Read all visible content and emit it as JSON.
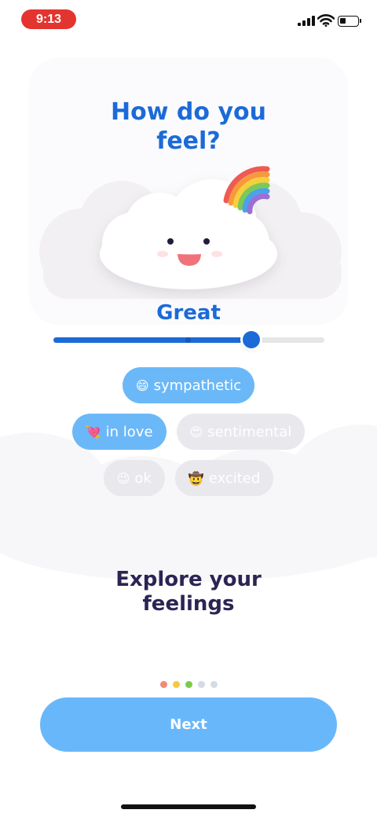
{
  "status_bar": {
    "time": "9:13"
  },
  "card": {
    "title": "How do you\nfeel?"
  },
  "mood": {
    "label": "Great",
    "slider_value": 0.73
  },
  "chips": [
    {
      "emoji": "😄",
      "label": "sympathetic",
      "selected": true
    },
    {
      "emoji": "💘",
      "label": "in love",
      "selected": true
    },
    {
      "emoji": "😍",
      "label": "sentimental",
      "selected": false
    },
    {
      "emoji": "😉",
      "label": "ok",
      "selected": false
    },
    {
      "emoji": "🤠",
      "label": "excited",
      "selected": false
    }
  ],
  "headline": "Explore your\nfeelings",
  "pagination": {
    "total": 5,
    "colors": [
      "#f08a7a",
      "#f5c944",
      "#7ccb4f",
      "#d4dbe6",
      "#d4dbe6"
    ]
  },
  "next_button": {
    "label": "Next"
  },
  "colors": {
    "accent": "#1c6ad8",
    "chip_on": "#6bb8f8",
    "chip_off": "#e9e8ec",
    "headline": "#2a2553",
    "button": "#69b7fb"
  }
}
